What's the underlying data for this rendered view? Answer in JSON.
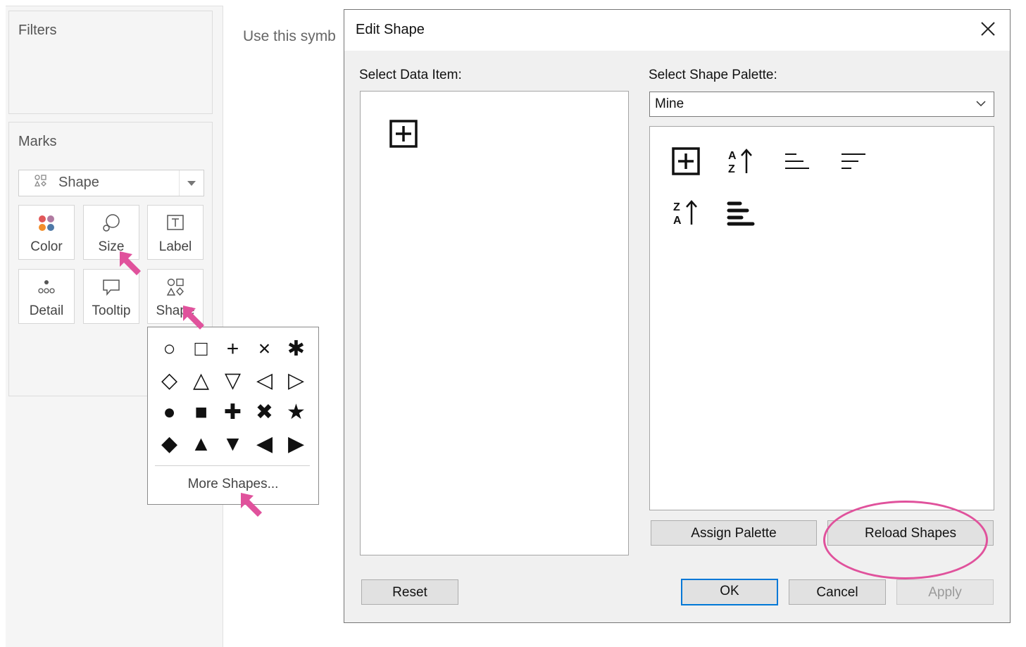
{
  "left_panel": {
    "filters": {
      "title": "Filters"
    },
    "marks": {
      "title": "Marks",
      "mark_type": {
        "icon": "shape-icon",
        "value": "Shape"
      },
      "tiles": [
        {
          "label": "Color",
          "icon": "color-dots-icon"
        },
        {
          "label": "Size",
          "icon": "size-icon"
        },
        {
          "label": "Label",
          "icon": "label-icon"
        },
        {
          "label": "Detail",
          "icon": "detail-icon"
        },
        {
          "label": "Tooltip",
          "icon": "tooltip-icon"
        },
        {
          "label": "Shape",
          "icon": "shape-icon"
        }
      ]
    }
  },
  "shape_popup": {
    "shapes": [
      "○",
      "□",
      "+",
      "×",
      "✱",
      "◇",
      "△",
      "▽",
      "◁",
      "▷",
      "●",
      "■",
      "✚",
      "✖",
      "★",
      "◆",
      "▲",
      "▼",
      "◀",
      "▶"
    ],
    "more_shapes": "More Shapes..."
  },
  "background_text": "Use this symb",
  "dialog": {
    "title": "Edit Shape",
    "select_data_item_label": "Select Data Item:",
    "select_shape_palette_label": "Select Shape Palette:",
    "palette_value": "Mine",
    "buttons": {
      "assign_palette": "Assign Palette",
      "reload_shapes": "Reload Shapes",
      "reset": "Reset",
      "ok": "OK",
      "cancel": "Cancel",
      "apply": "Apply"
    },
    "palette_shapes": [
      "plus-box-icon",
      "sort-az-icon",
      "align-left-lines-icon",
      "sort-lines-icon",
      "sort-za-icon",
      "bold-lines-icon"
    ]
  },
  "annotation_color": "#e0529c"
}
